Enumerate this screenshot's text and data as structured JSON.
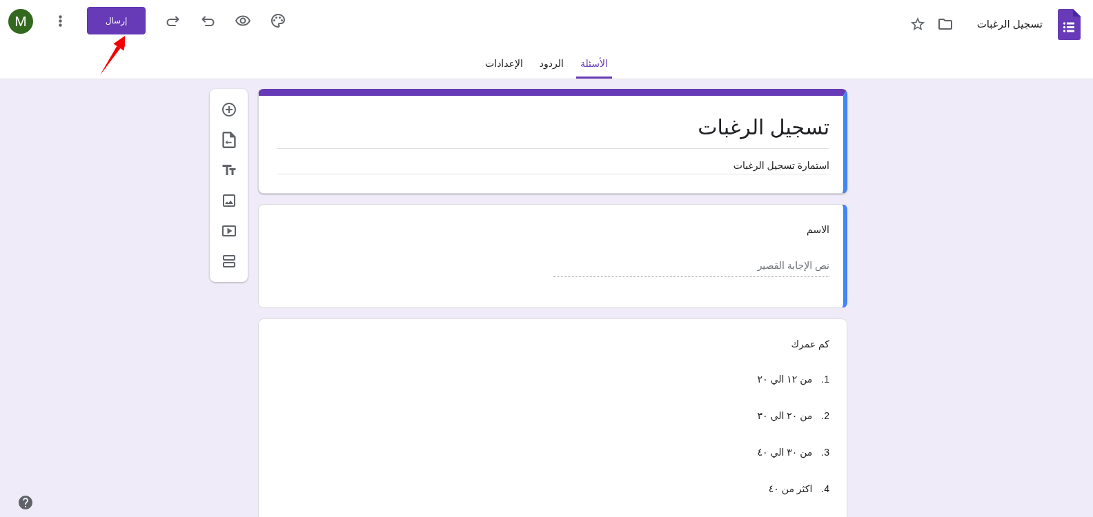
{
  "header": {
    "title": "تسجيل الرغبات",
    "send_button": "إرسال",
    "avatar": "M"
  },
  "tabs": [
    {
      "label": "الأسئلة",
      "selected": true
    },
    {
      "label": "الردود",
      "selected": false
    },
    {
      "label": "الإعدادات",
      "selected": false
    }
  ],
  "form": {
    "title": "تسجيل الرغبات",
    "description": "استمارة تسجيل الرغبات",
    "selected": true
  },
  "questions": [
    {
      "kind": "short_answer",
      "title": "الاسم",
      "placeholder": "نص الإجابة القصير",
      "selected": true
    },
    {
      "kind": "list",
      "title": "كم عمرك",
      "selected": false,
      "options": [
        {
          "number": "1.",
          "text": "من ١٢ الي ٢٠"
        },
        {
          "number": "2.",
          "text": "من ٢٠ الي ٣٠"
        },
        {
          "number": "3.",
          "text": "من ٣٠ الي ٤٠"
        },
        {
          "number": "4.",
          "text": "اكثر من ٤٠"
        }
      ]
    }
  ]
}
